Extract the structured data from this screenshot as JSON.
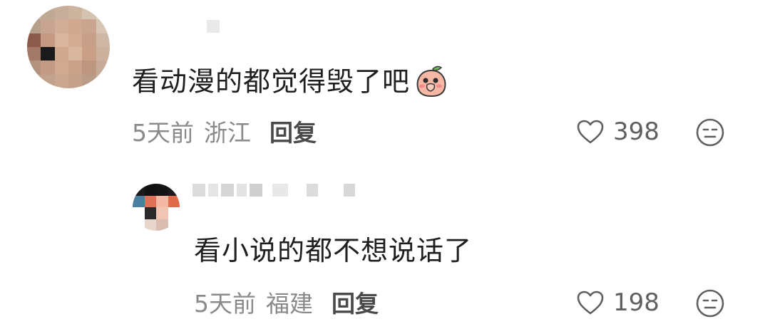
{
  "comments": [
    {
      "text": "看动漫的都觉得毁了吧",
      "sticker_icon": "peach-covering-mouth-sticker",
      "time": "5天前",
      "region": "浙江",
      "reply_label": "回复",
      "likes": "398",
      "username_visible": false
    }
  ],
  "replies": [
    {
      "text": "看小说的都不想说话了",
      "time": "5天前",
      "region": "福建",
      "reply_label": "回复",
      "likes": "198",
      "username_visible": false
    }
  ],
  "icons": {
    "like": "heart-outline-icon",
    "dislike": "neutral-face-icon"
  },
  "colors": {
    "text_primary": "#1f1f1f",
    "text_meta": "#8a8a8a",
    "reply_button": "#4a4a4a",
    "icon": "#606060"
  }
}
